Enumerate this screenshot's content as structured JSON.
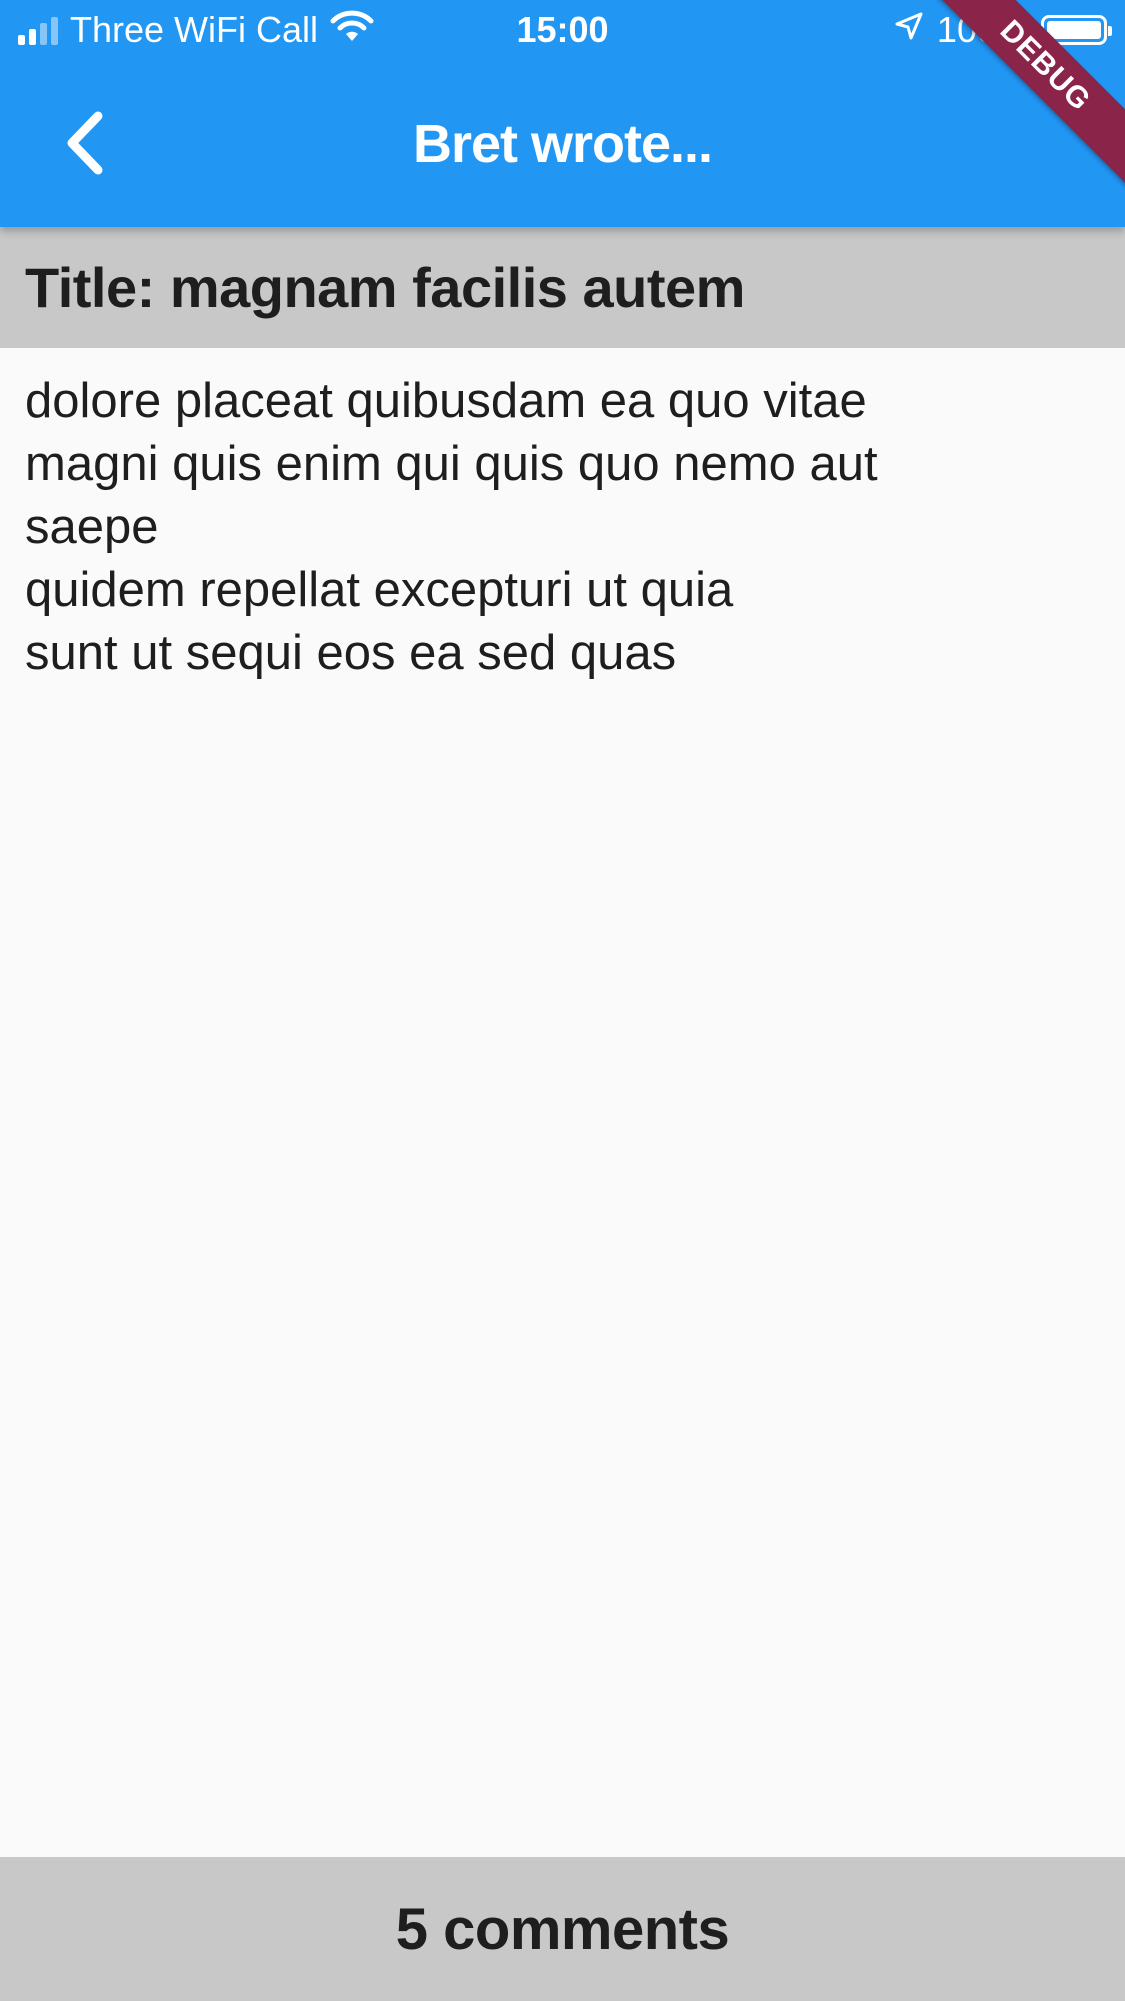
{
  "status_bar": {
    "carrier": "Three WiFi Call",
    "time": "15:00",
    "battery_percent": "100%",
    "battery_level": 1.0,
    "icons": [
      "signal-icon",
      "wifi-icon",
      "location-arrow-icon",
      "battery-icon"
    ]
  },
  "app_bar": {
    "title": "Bret wrote...",
    "back_icon": "chevron-left-icon",
    "debug_banner": "DEBUG"
  },
  "post": {
    "title": "Title: magnam facilis autem",
    "body": "dolore placeat quibusdam ea quo vitae\nmagni quis enim qui quis quo nemo aut\nsaepe\nquidem repellat excepturi ut quia\nsunt ut sequi eos ea sed quas"
  },
  "footer": {
    "comments_label": "5 comments"
  },
  "colors": {
    "app_bar": "#2196f3",
    "title_bar": "#c8c8c8",
    "background": "#fafafa",
    "debug_banner": "#8b2449",
    "text": "#1e1e1e"
  }
}
